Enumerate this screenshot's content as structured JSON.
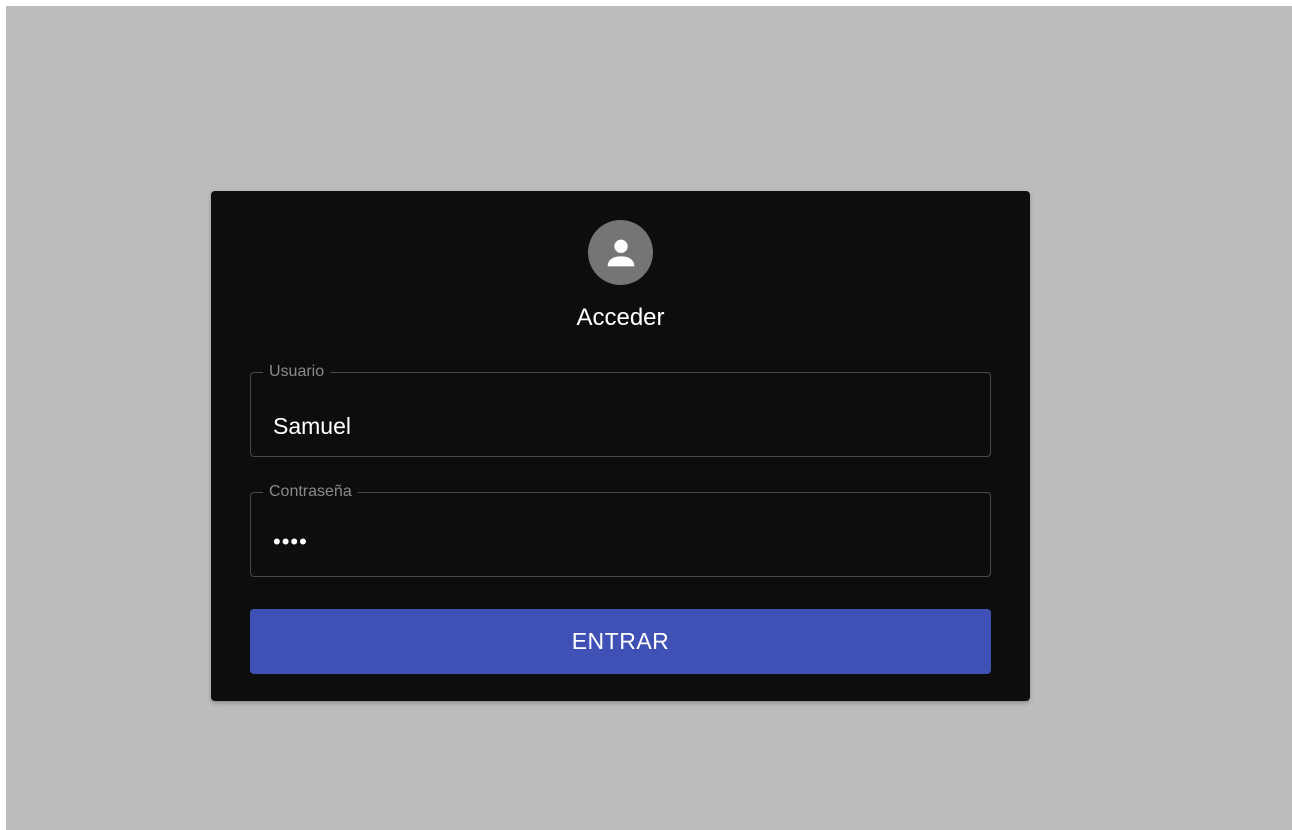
{
  "login": {
    "title": "Acceder",
    "avatar_icon": "person-icon",
    "username": {
      "label": "Usuario",
      "value": "Samuel"
    },
    "password": {
      "label": "Contraseña",
      "masked_value": "••••"
    },
    "submit_label": "ENTRAR"
  },
  "colors": {
    "page_background": "#bdbbbb",
    "card_background": "#0d0d0d",
    "button_accent": "#3f51b5",
    "avatar_background": "#757575"
  }
}
